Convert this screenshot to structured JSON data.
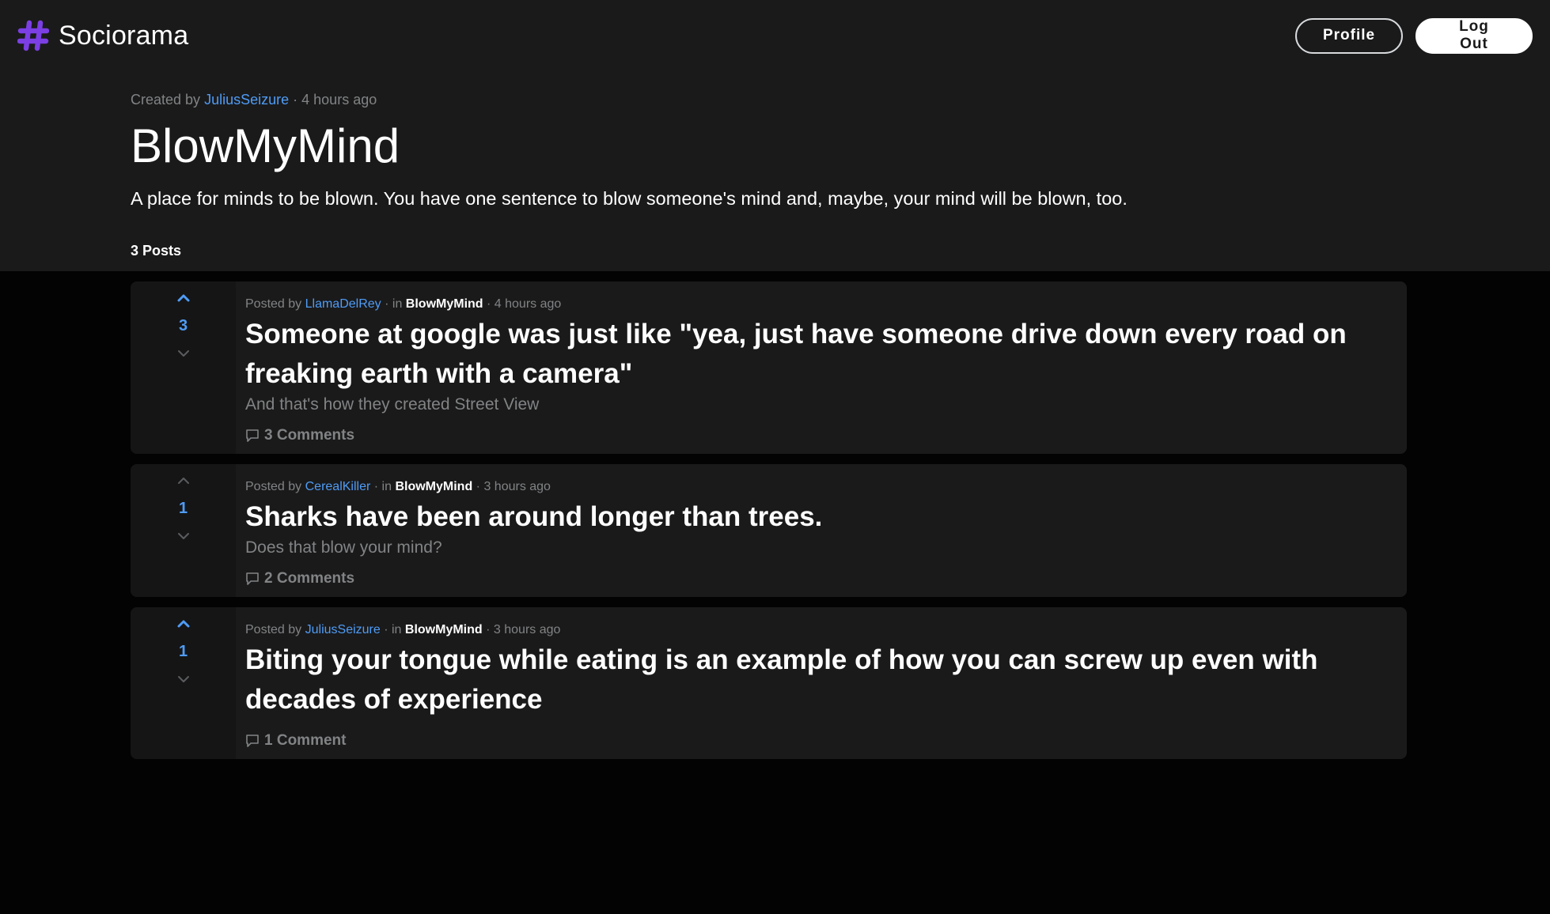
{
  "app": {
    "name": "Sociorama",
    "accent_color": "#7b3fe4",
    "link_color": "#4f9cf5"
  },
  "nav": {
    "profile_label": "Profile",
    "logout_label": "Log Out"
  },
  "community": {
    "created_prefix": "Created by",
    "creator": "JuliusSeizure",
    "created_suffix": "· 4 hours ago",
    "title": "BlowMyMind",
    "description": "A place for minds to be blown. You have one sentence to blow someone's mind and, maybe, your mind will be blown, too.",
    "post_count_label": "3 Posts"
  },
  "posts": [
    {
      "score": "3",
      "upvoted": true,
      "posted_prefix": "Posted by",
      "author": "LlamaDelRey",
      "in_label": "· in",
      "community": "BlowMyMind",
      "time": "· 4 hours ago",
      "title": "Someone at google was just like \"yea, just have someone drive down every road on freaking earth with a camera\"",
      "body": "And that's how they created Street View",
      "comments": "3 Comments"
    },
    {
      "score": "1",
      "upvoted": false,
      "posted_prefix": "Posted by",
      "author": "CerealKiller",
      "in_label": "· in",
      "community": "BlowMyMind",
      "time": "· 3 hours ago",
      "title": "Sharks have been around longer than trees.",
      "body": "Does that blow your mind?",
      "comments": "2 Comments"
    },
    {
      "score": "1",
      "upvoted": true,
      "posted_prefix": "Posted by",
      "author": "JuliusSeizure",
      "in_label": "· in",
      "community": "BlowMyMind",
      "time": "· 3 hours ago",
      "title": "Biting your tongue while eating is an example of how you can screw up even with decades of experience",
      "body": "",
      "comments": "1 Comment"
    }
  ]
}
